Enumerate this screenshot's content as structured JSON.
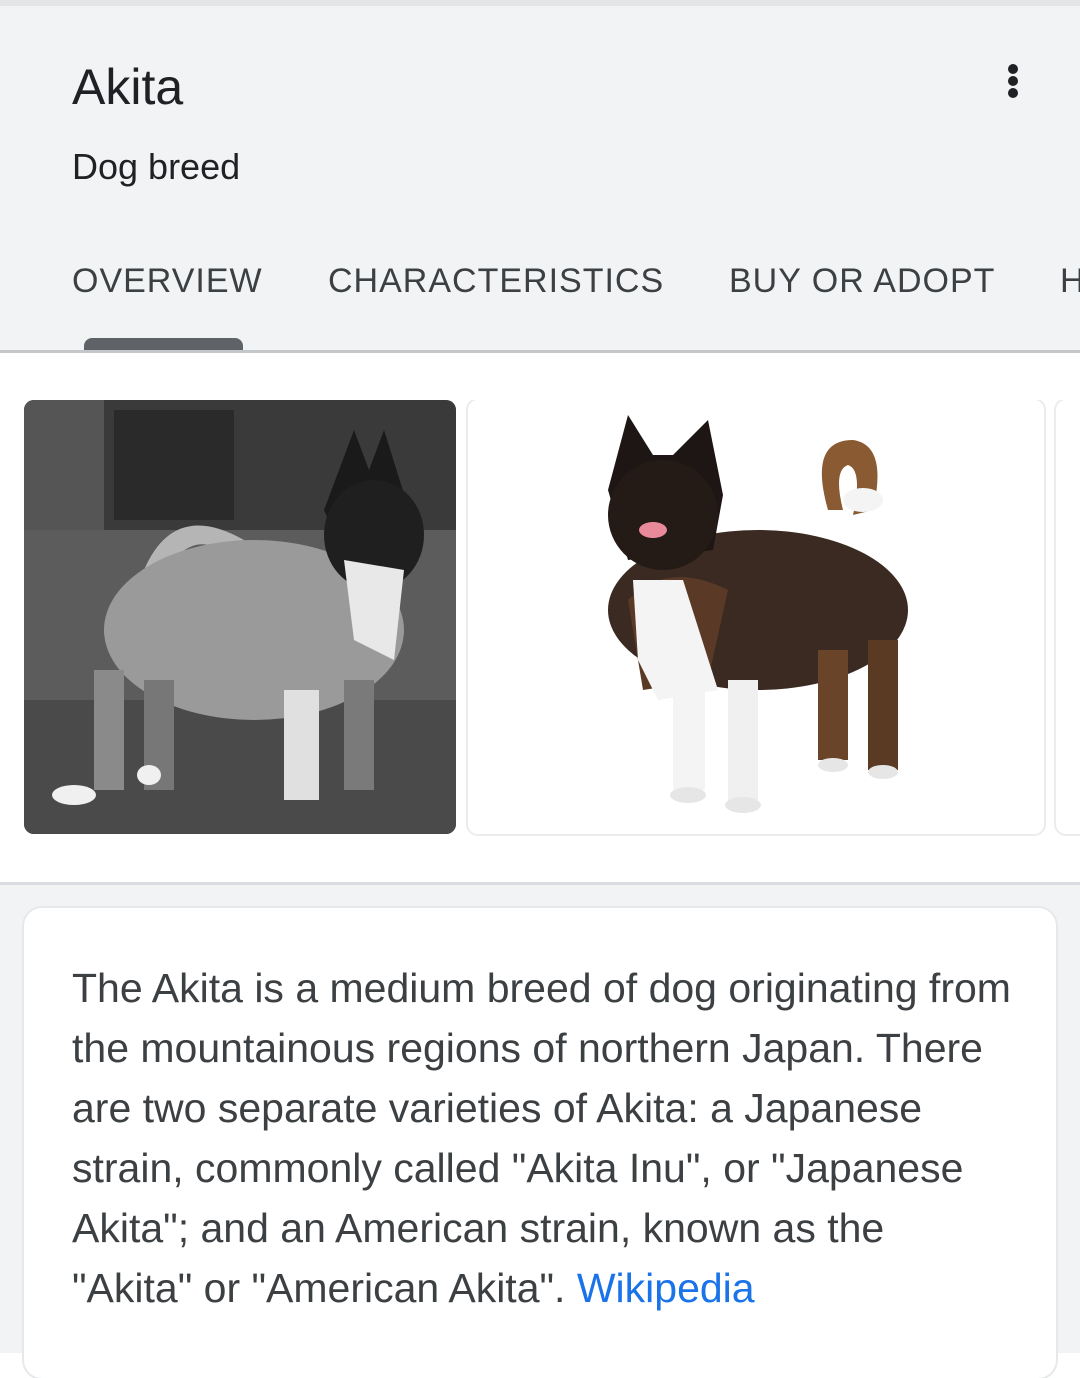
{
  "header": {
    "title": "Akita",
    "subtitle": "Dog breed"
  },
  "tabs": [
    {
      "label": "OVERVIEW",
      "selected": true
    },
    {
      "label": "CHARACTERISTICS",
      "selected": false
    },
    {
      "label": "BUY OR ADOPT",
      "selected": false
    },
    {
      "label": "H",
      "selected": false
    }
  ],
  "description": {
    "text": "The Akita is a medium breed of dog originating from the mountainous regions of northern Japan. There are two separate varieties of Akita: a Japanese strain, commonly called \"Akita Inu\", or \"Japanese Akita\"; and an American strain, known as the \"Akita\" or \"American Akita\".",
    "source_link": "Wikipedia"
  },
  "colors": {
    "header_bg": "#f1f3f4",
    "link": "#1a73e8",
    "tab_indicator": "#5f6368"
  }
}
